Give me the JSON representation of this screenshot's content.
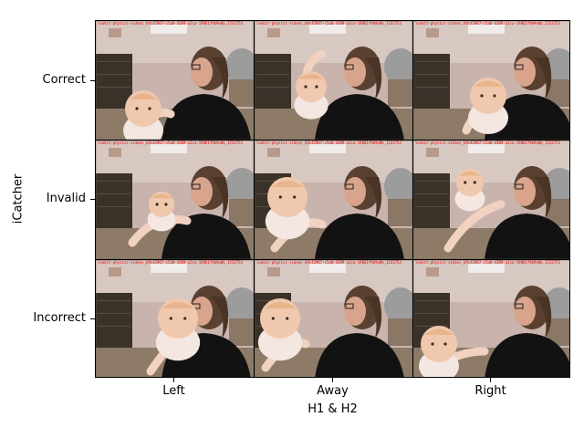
{
  "figure": {
    "xlabel": "H1 & H2",
    "ylabel": "iCatcher",
    "columns": [
      "Left",
      "Away",
      "Right"
    ],
    "rows": [
      "Correct",
      "Invalid",
      "Incorrect"
    ],
    "frame_caption": "lookit-physics-videos_b9c42967-c5a8-4389-a2ca-19861f9b9e8b_1533753",
    "cells": [
      {
        "row": "Correct",
        "col": "Left",
        "baby_pose": "facing-camera"
      },
      {
        "row": "Correct",
        "col": "Away",
        "baby_pose": "arm-raised"
      },
      {
        "row": "Correct",
        "col": "Right",
        "baby_pose": "over-shoulder"
      },
      {
        "row": "Invalid",
        "col": "Left",
        "baby_pose": "low-hidden"
      },
      {
        "row": "Invalid",
        "col": "Away",
        "baby_pose": "head-down"
      },
      {
        "row": "Invalid",
        "col": "Right",
        "baby_pose": "looking-right"
      },
      {
        "row": "Incorrect",
        "col": "Left",
        "baby_pose": "hand-to-mouth"
      },
      {
        "row": "Incorrect",
        "col": "Away",
        "baby_pose": "leaning-left"
      },
      {
        "row": "Incorrect",
        "col": "Right",
        "baby_pose": "low-left"
      }
    ]
  }
}
